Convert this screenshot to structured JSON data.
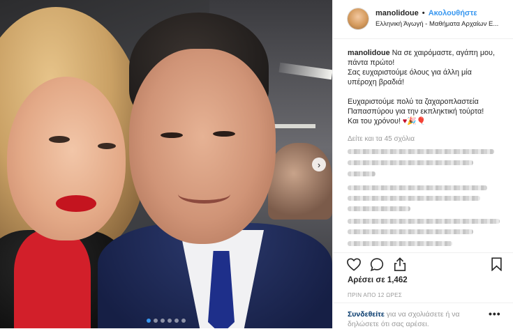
{
  "post": {
    "username": "manolidoue",
    "separator": "•",
    "follow_label": "Ακολουθήστε",
    "location": "Ελληνική Άγωγή - Μαθήματα Αρχαίων Ε...",
    "caption": {
      "line1": "Να σε χαιρόμαστε, αγάπη μου,",
      "line2": "πάντα πρώτο!",
      "line3": "Σας ευχαριστούμε όλους για άλλη μία",
      "line4": "υπέροχη βραδιά!",
      "line5": "Ευχαριστούμε πολύ τα ζαχαροπλαστεία",
      "line6": "Παπασπύρου για την εκπληκτική τούρτα!",
      "line7": "Και του χρόνου!",
      "emojis": "♥🎉🎈"
    },
    "view_all_comments": "Δείτε και τα 45 σχόλια",
    "likes": "Αρέσει σε 1,462",
    "time_ago": "ΠΡΙΝ ΑΠΟ 12 ΩΡΕΣ",
    "login": {
      "link": "Συνδεθείτε",
      "text": " για να σχολιάσετε ή να δηλώσετε ότι σας αρέσει."
    },
    "more_label": "•••",
    "next_arrow": "›"
  },
  "icons": {
    "like": "heart-icon",
    "comment": "comment-icon",
    "share": "share-icon",
    "save": "bookmark-icon"
  },
  "colors": {
    "accent": "#3897f0",
    "text": "#262626",
    "muted": "#999999",
    "link_dark": "#003569"
  },
  "carousel": {
    "slides": 6,
    "active_index": 0
  }
}
